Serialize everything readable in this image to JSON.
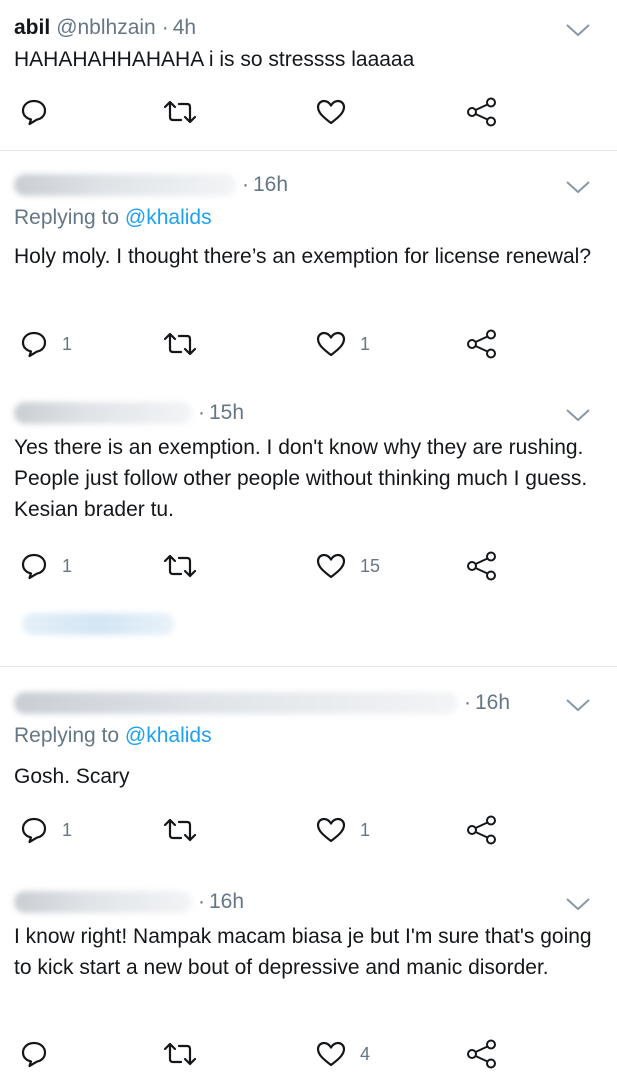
{
  "tweets": [
    {
      "name": "abil",
      "handle": "@nblhzain",
      "time": "4h",
      "text": "HAHAHAHHAHAHA i is so stressss laaaaa",
      "replies": "",
      "likes": ""
    },
    {
      "time": "16h",
      "replying_label": "Replying to",
      "replying_handle": "@khalids",
      "text": "Holy moly. I thought there’s an exemption for license renewal?",
      "replies": "1",
      "likes": "1"
    },
    {
      "time": "15h",
      "text": "Yes there is an exemption. I don't know why they are rushing. People just follow other people without thinking much I guess. Kesian brader tu.",
      "replies": "1",
      "likes": "15"
    },
    {
      "time": "16h",
      "replying_label": "Replying to",
      "replying_handle": "@khalids",
      "text": "Gosh. Scary",
      "replies": "1",
      "likes": "1"
    },
    {
      "time": "16h",
      "text": "I know right! Nampak macam biasa je but I'm sure that's going to kick start a new bout of depressive and manic disorder.",
      "replies": "",
      "likes": "4"
    }
  ],
  "icons": {
    "reply": "reply-icon",
    "retweet": "retweet-icon",
    "like": "heart-icon",
    "share": "share-icon",
    "more": "chevron-down-icon"
  },
  "colors": {
    "text": "#14171a",
    "secondary": "#657786",
    "link": "#1da1f2",
    "divider": "#e1e8ed"
  }
}
